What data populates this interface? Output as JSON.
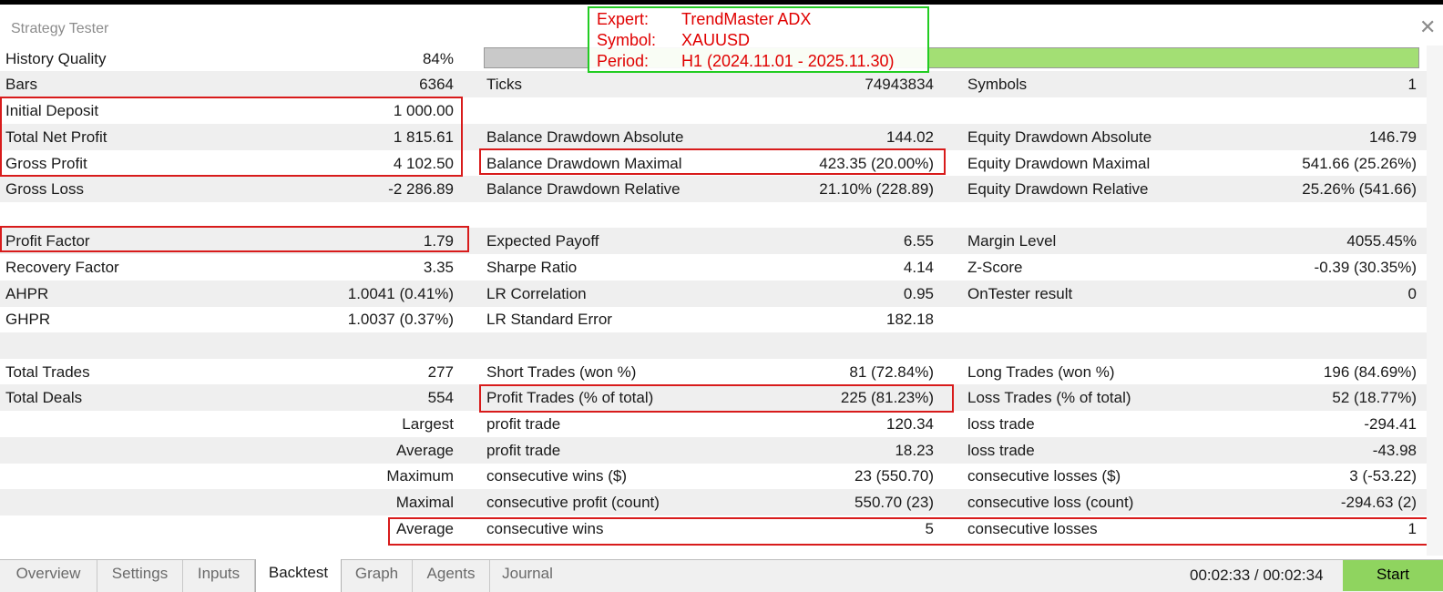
{
  "window": {
    "title": "Strategy Tester"
  },
  "annotation": {
    "expert_label": "Expert:",
    "expert_value": "TrendMaster ADX",
    "symbol_label": "Symbol:",
    "symbol_value": "XAUUSD",
    "period_label": "Period:",
    "period_value": "H1 (2024.11.01 - 2025.11.30)"
  },
  "history": {
    "label": "History Quality",
    "value": "84%",
    "progress_fraction": 0.84
  },
  "colors": {
    "progress_green": "#a3df74",
    "start_green": "#8fd45f",
    "highlight_red": "#d81b1b",
    "annotation_green": "#22cc22",
    "annotation_text": "#e00000"
  },
  "rows": {
    "bars": {
      "l": "Bars",
      "lv": "6364",
      "m": "Ticks",
      "mv": "74943834",
      "r": "Symbols",
      "rv": "1"
    },
    "deposit": {
      "l": "Initial Deposit",
      "lv": "1 000.00"
    },
    "netprofit": {
      "l": "Total Net Profit",
      "lv": "1 815.61",
      "m": "Balance Drawdown Absolute",
      "mv": "144.02",
      "r": "Equity Drawdown Absolute",
      "rv": "146.79"
    },
    "grossprofit": {
      "l": "Gross Profit",
      "lv": "4 102.50",
      "m": "Balance Drawdown Maximal",
      "mv": "423.35 (20.00%)",
      "r": "Equity Drawdown Maximal",
      "rv": "541.66 (25.26%)"
    },
    "grossloss": {
      "l": "Gross Loss",
      "lv": "-2 286.89",
      "m": "Balance Drawdown Relative",
      "mv": "21.10% (228.89)",
      "r": "Equity Drawdown Relative",
      "rv": "25.26% (541.66)"
    },
    "profitfactor": {
      "l": "Profit Factor",
      "lv": "1.79",
      "m": "Expected Payoff",
      "mv": "6.55",
      "r": "Margin Level",
      "rv": "4055.45%"
    },
    "recovery": {
      "l": "Recovery Factor",
      "lv": "3.35",
      "m": "Sharpe Ratio",
      "mv": "4.14",
      "r": "Z-Score",
      "rv": "-0.39 (30.35%)"
    },
    "ahpr": {
      "l": "AHPR",
      "lv": "1.0041 (0.41%)",
      "m": "LR Correlation",
      "mv": "0.95",
      "r": "OnTester result",
      "rv": "0"
    },
    "ghpr": {
      "l": "GHPR",
      "lv": "1.0037 (0.37%)",
      "m": "LR Standard Error",
      "mv": "182.18"
    },
    "totaltrades": {
      "l": "Total Trades",
      "lv": "277",
      "m": "Short Trades (won %)",
      "mv": "81 (72.84%)",
      "r": "Long Trades (won %)",
      "rv": "196 (84.69%)"
    },
    "totaldeals": {
      "l": "Total Deals",
      "lv": "554",
      "m": "Profit Trades (% of total)",
      "mv": "225 (81.23%)",
      "r": "Loss Trades (% of total)",
      "rv": "52 (18.77%)"
    },
    "largest": {
      "lv": "Largest",
      "m": "profit trade",
      "mv": "120.34",
      "r": "loss trade",
      "rv": "-294.41"
    },
    "average": {
      "lv": "Average",
      "m": "profit trade",
      "mv": "18.23",
      "r": "loss trade",
      "rv": "-43.98"
    },
    "maximum": {
      "lv": "Maximum",
      "m": "consecutive wins ($)",
      "mv": "23 (550.70)",
      "r": "consecutive losses ($)",
      "rv": "3 (-53.22)"
    },
    "maximal": {
      "lv": "Maximal",
      "m": "consecutive profit (count)",
      "mv": "550.70 (23)",
      "r": "consecutive loss (count)",
      "rv": "-294.63 (2)"
    },
    "average2": {
      "lv": "Average",
      "m": "consecutive wins",
      "mv": "5",
      "r": "consecutive losses",
      "rv": "1"
    }
  },
  "tabs": [
    "Overview",
    "Settings",
    "Inputs",
    "Backtest",
    "Graph",
    "Agents",
    "Journal"
  ],
  "active_tab": "Backtest",
  "timer": "00:02:33 / 00:02:34",
  "start_label": "Start"
}
